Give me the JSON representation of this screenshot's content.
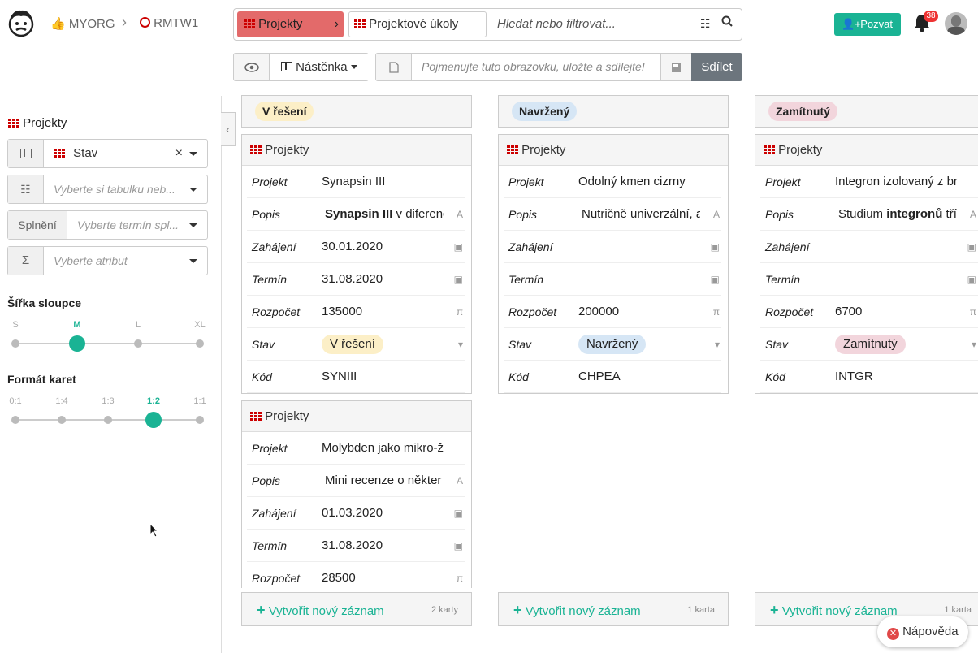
{
  "header": {
    "org": "MYORG",
    "project_code": "RMTW1",
    "table_pill": "Projekty",
    "linked_pill": "Projektové úkoly",
    "search_placeholder": "Hledat nebo filtrovat...",
    "invite_label": "Pozvat",
    "notification_count": "38"
  },
  "toolbar": {
    "view_label": "Nástěnka",
    "view_name_placeholder": "Pojmenujte tuto obrazovku, uložte a sdílejte!",
    "share_label": "Sdílet"
  },
  "sidebar": {
    "title": "Projekty",
    "group_by": "Stav",
    "table_placeholder": "Vyberte si tabulku neb...",
    "due_prefix": "Splnění",
    "due_placeholder": "Vyberte termín spl...",
    "attribute_placeholder": "Vyberte atribut",
    "column_width_label": "Šířka sloupce",
    "column_width_options": [
      "S",
      "M",
      "L",
      "XL"
    ],
    "column_width_selected": "M",
    "card_format_label": "Formát karet",
    "card_format_options": [
      "0:1",
      "1:4",
      "1:3",
      "1:2",
      "1:1"
    ],
    "card_format_selected": "1:2"
  },
  "columns": [
    {
      "status": "V řešení",
      "color": "#fcefc7",
      "cards": [
        {
          "title": "Projekty",
          "rows": [
            {
              "k": "Projekt",
              "v": "Synapsin III"
            },
            {
              "k": "Popis",
              "v_bold": "Synapsin III",
              "v": " v diferenc"
            },
            {
              "k": "Zahájení",
              "v": "30.01.2020"
            },
            {
              "k": "Termín",
              "v": "31.08.2020"
            },
            {
              "k": "Rozpočet",
              "v": "135000"
            },
            {
              "k": "Stav",
              "chip": "V řešení"
            },
            {
              "k": "Kód",
              "v": "SYNIII"
            }
          ]
        },
        {
          "title": "Projekty",
          "rows": [
            {
              "k": "Projekt",
              "v": "Molybden jako mikro-živ"
            },
            {
              "k": "Popis",
              "v": "Mini recenze o někter"
            },
            {
              "k": "Zahájení",
              "v": "01.03.2020"
            },
            {
              "k": "Termín",
              "v": "31.08.2020"
            },
            {
              "k": "Rozpočet",
              "v": "28500"
            }
          ]
        }
      ],
      "add_label": "Vytvořit nový záznam",
      "count": "2 karty"
    },
    {
      "status": "Navržený",
      "color": "#d6e6f5",
      "cards": [
        {
          "title": "Projekty",
          "rows": [
            {
              "k": "Projekt",
              "v": "Odolný kmen cizrny"
            },
            {
              "k": "Popis",
              "v": "Nutričně univerzální, a"
            },
            {
              "k": "Zahájení",
              "v": ""
            },
            {
              "k": "Termín",
              "v": ""
            },
            {
              "k": "Rozpočet",
              "v": "200000"
            },
            {
              "k": "Stav",
              "chip": "Navržený"
            },
            {
              "k": "Kód",
              "v": "CHPEA"
            }
          ]
        }
      ],
      "add_label": "Vytvořit nový záznam",
      "count": "1 karta"
    },
    {
      "status": "Zamítnutý",
      "color": "#f2d5dc",
      "cards": [
        {
          "title": "Projekty",
          "rows": [
            {
              "k": "Projekt",
              "v": "Integron izolovaný z bro"
            },
            {
              "k": "Popis",
              "v_pre": "Studium ",
              "v_bold": "integronů",
              "v": " tříc"
            },
            {
              "k": "Zahájení",
              "v": ""
            },
            {
              "k": "Termín",
              "v": ""
            },
            {
              "k": "Rozpočet",
              "v": "6700"
            },
            {
              "k": "Stav",
              "chip": "Zamítnutý"
            },
            {
              "k": "Kód",
              "v": "INTGR"
            }
          ]
        }
      ],
      "add_label": "Vytvořit nový záznam",
      "count": "1 karta"
    }
  ],
  "help_label": "Nápověda"
}
